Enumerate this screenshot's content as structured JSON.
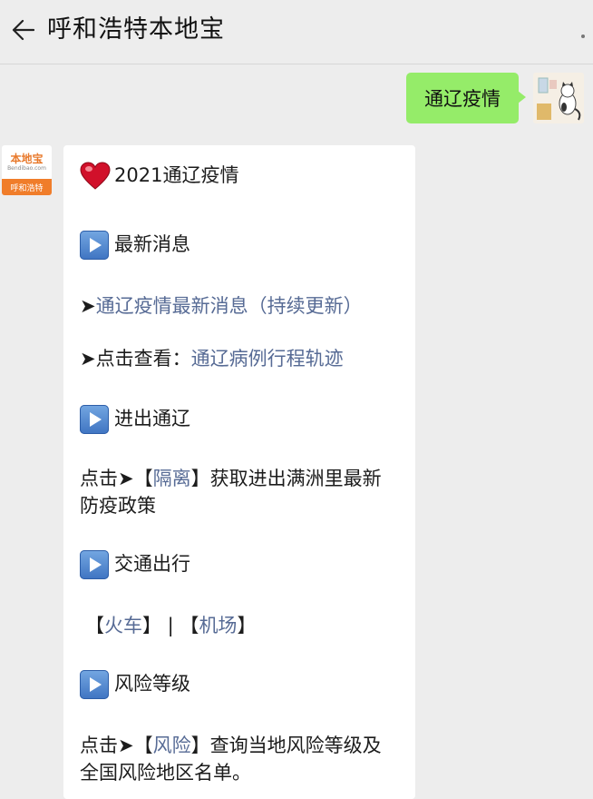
{
  "header": {
    "title": "呼和浩特本地宝"
  },
  "user_message": {
    "text": "通辽疫情"
  },
  "bot_avatar": {
    "logo_text": "本地宝",
    "logo_sub": "Bendibao.com",
    "label": "呼和浩特"
  },
  "article": {
    "title": "2021通辽疫情",
    "section1": "最新消息",
    "item1_prefix": "➤",
    "item1_link": "通辽疫情最新消息（持续更新）",
    "item2_prefix": "➤点击查看：",
    "item2_link": "通辽病例行程轨迹",
    "section2": "进出通辽",
    "para1_prefix": "点击➤【",
    "para1_link": "隔离",
    "para1_suffix": "】获取进出满洲里最新",
    "para1_line2": "防疫政策",
    "section3": "交通出行",
    "trans_open1": "【",
    "trans_link1": "火车",
    "trans_mid": "】 | 【",
    "trans_link2": "机场",
    "trans_close": "】",
    "section4": "风险等级",
    "para2_prefix": "点击➤【",
    "para2_link": "风险",
    "para2_suffix": "】查询当地风险等级及",
    "para2_line2": "全国风险地区名单。"
  },
  "colors": {
    "background": "#ededed",
    "user_bubble": "#95ec69",
    "link": "#576b95",
    "brand_orange": "#f07d2a"
  },
  "icons": [
    "back-arrow-icon",
    "more-dots-icon",
    "heart-icon",
    "play-icon"
  ]
}
